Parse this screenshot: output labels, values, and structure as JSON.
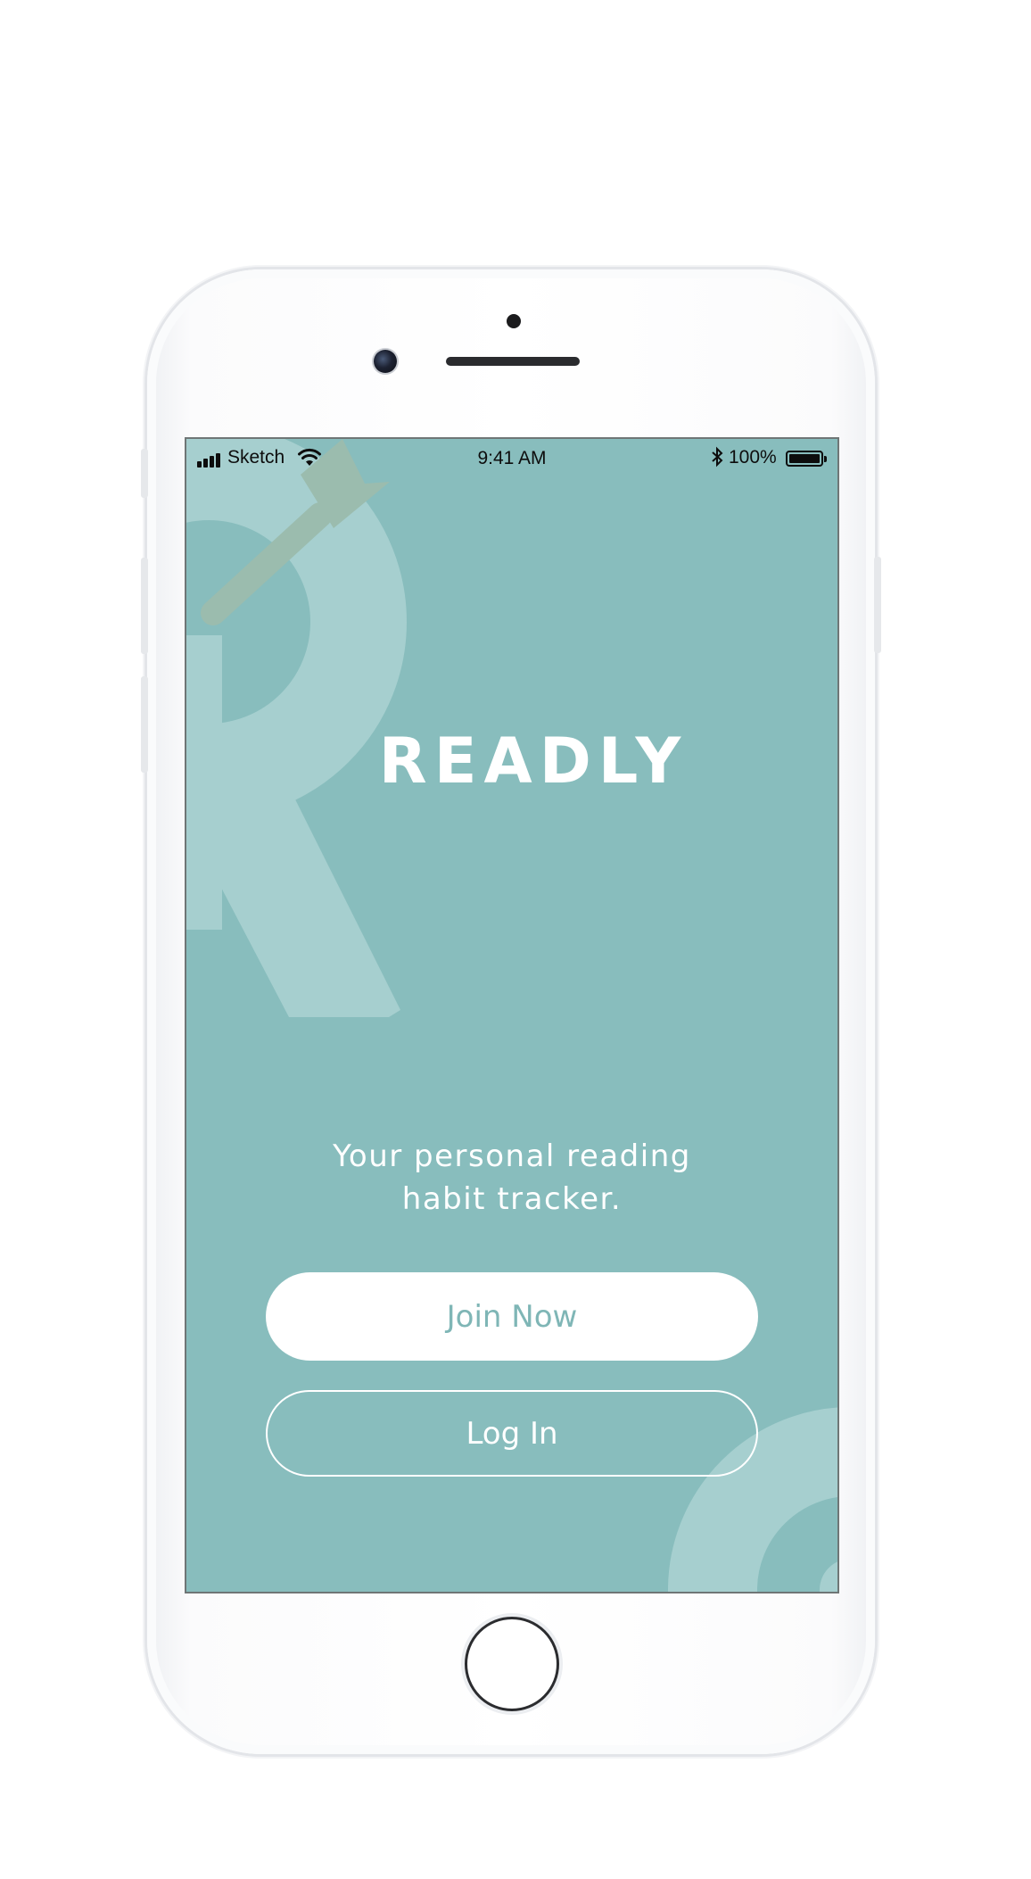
{
  "status_bar": {
    "carrier": "Sketch",
    "time": "9:41 AM",
    "battery_percent": "100%",
    "battery_level": 1.0,
    "icons": [
      "signal-icon",
      "wifi-icon",
      "bluetooth-icon",
      "battery-icon"
    ]
  },
  "app": {
    "name": "READLY",
    "tagline_line1": "Your personal reading",
    "tagline_line2": "habit tracker."
  },
  "actions": {
    "join_label": "Join Now",
    "login_label": "Log In"
  },
  "colors": {
    "background": "#88bdbd",
    "decoration": "#a6cfcf",
    "arrow": "#9bbcae",
    "button_text": "#7fb6b6",
    "white": "#ffffff"
  }
}
